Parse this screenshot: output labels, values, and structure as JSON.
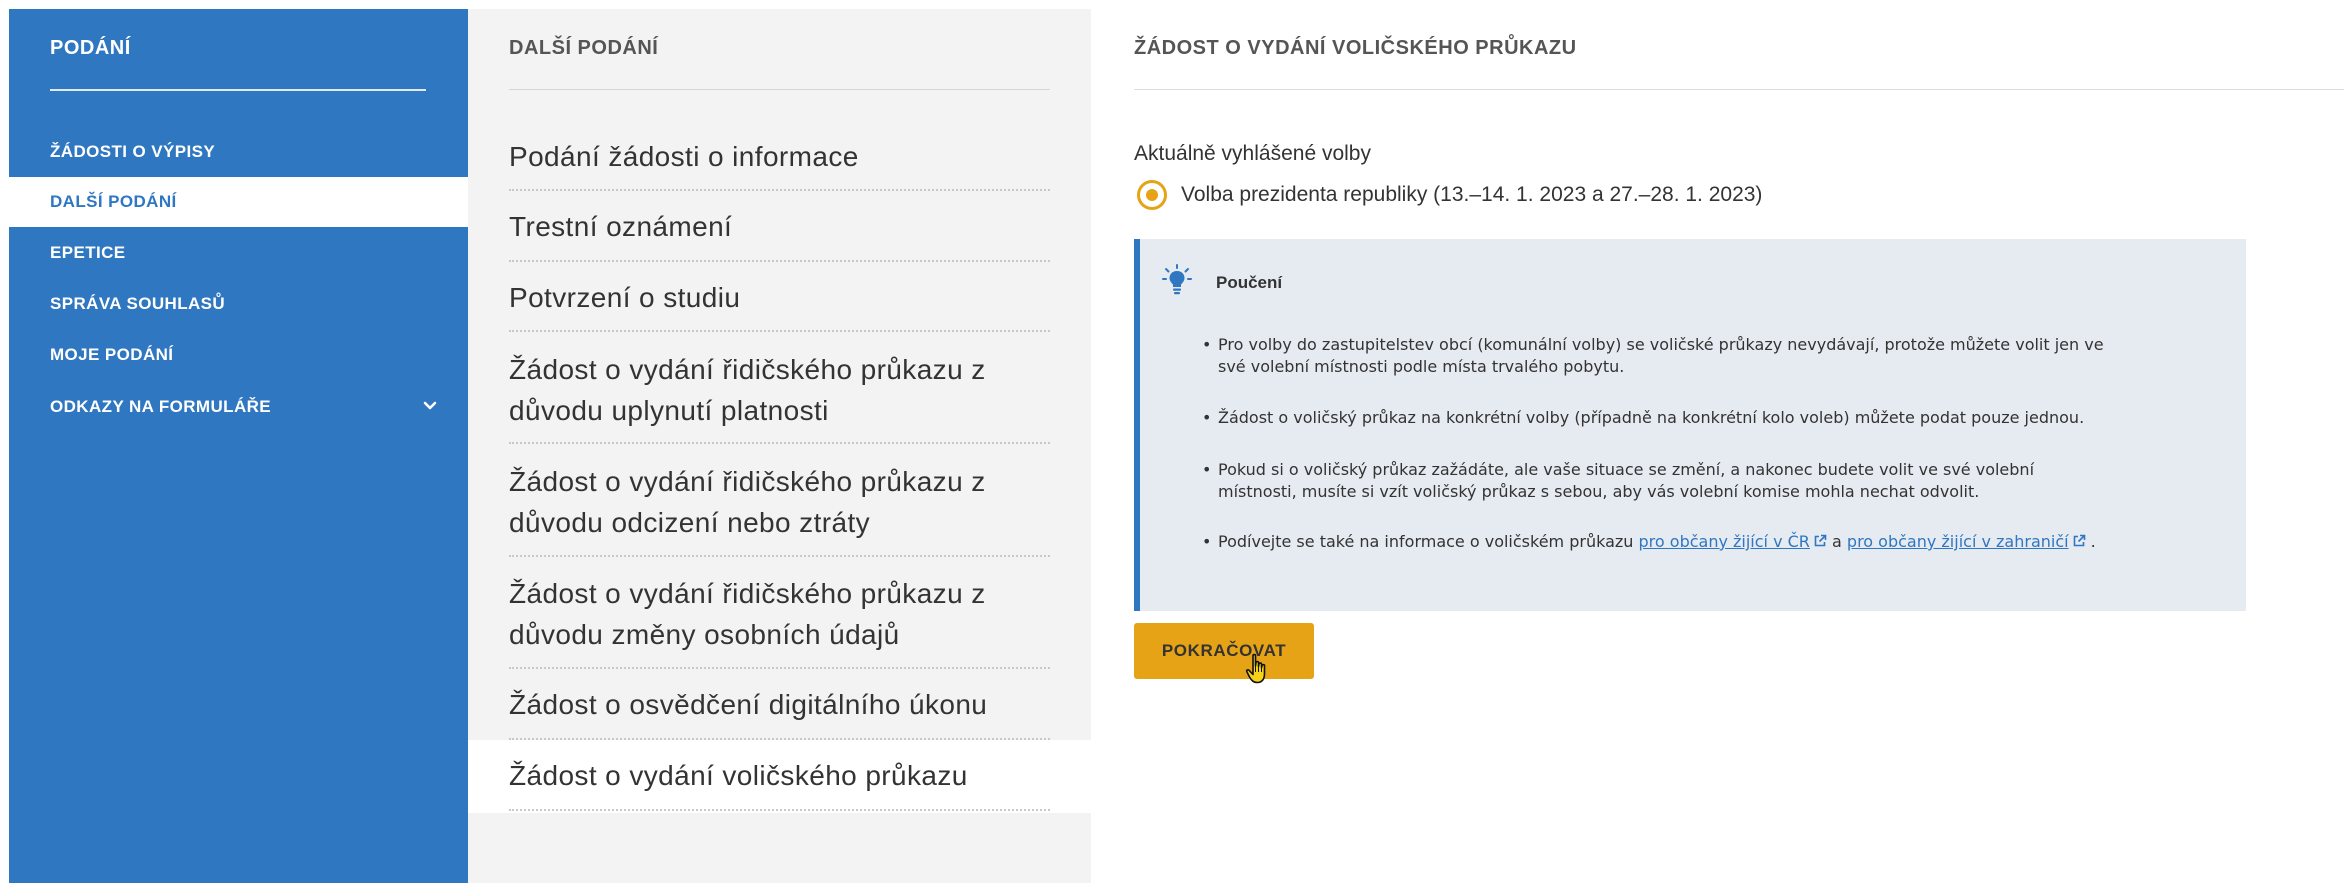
{
  "sidebar": {
    "title": "PODÁNÍ",
    "items": [
      {
        "label": "ŽÁDOSTI O VÝPISY"
      },
      {
        "label": "DALŠÍ PODÁNÍ"
      },
      {
        "label": "EPETICE"
      },
      {
        "label": "SPRÁVA SOUHLASŮ"
      },
      {
        "label": "MOJE PODÁNÍ"
      },
      {
        "label": "ODKAZY NA FORMULÁŘE"
      }
    ],
    "active_index": 1
  },
  "middle": {
    "title": "DALŠÍ PODÁNÍ",
    "items": [
      {
        "label": "Podání žádosti o informace"
      },
      {
        "label": "Trestní oznámení"
      },
      {
        "label": "Potvrzení o studiu"
      },
      {
        "line1": "Žádost o vydání řidičského průkazu z",
        "line2": "důvodu uplynutí platnosti"
      },
      {
        "line1": "Žádost o vydání řidičského průkazu z",
        "line2": "důvodu odcizení nebo ztráty"
      },
      {
        "line1": "Žádost o vydání řidičského průkazu z",
        "line2": "důvodu změny osobních údajů"
      },
      {
        "label": "Žádost o osvědčení digitálního úkonu"
      },
      {
        "label": "Žádost o vydání voličského průkazu"
      }
    ]
  },
  "content": {
    "title": "ŽÁDOST O VYDÁNÍ VOLIČSKÉHO PRŮKAZU",
    "elections_label": "Aktuálně vyhlášené volby",
    "election_option": "Volba prezidenta republiky (13.–14. 1. 2023 a 27.–28. 1. 2023)",
    "info": {
      "title": "Poučení",
      "bullets": [
        {
          "line1": "Pro volby do zastupitelstev obcí (komunální volby) se voličské průkazy nevydávají, protože můžete volit jen ve",
          "line2": "své volební místnosti podle místa trvalého pobytu."
        },
        {
          "line1": "Žádost o voličský průkaz na konkrétní volby (případně na konkrétní kolo voleb) můžete podat pouze jednou."
        },
        {
          "line1": "Pokud si o voličský průkaz zažádáte, ale vaše situace se změní, a nakonec budete volit ve své volební",
          "line2": "místnosti, musíte si vzít voličský průkaz s sebou, aby vás volební komise mohla nechat odvolit."
        },
        {
          "prefix": "Podívejte se také na informace o voličském průkazu ",
          "link1": "pro občany žijící v ČR",
          "middle": " a ",
          "link2": "pro občany žijící v zahraničí",
          "suffix": " ."
        }
      ]
    },
    "continue_button": "POKRAČOVAT"
  },
  "colors": {
    "primary_blue": "#2f77c0",
    "accent_yellow": "#e7a316",
    "info_bg": "#e6eaf1",
    "middle_bg": "#f3f3f3"
  },
  "icons": {
    "info": "lightbulb-icon",
    "expand": "chevron-down-icon",
    "external": "external-link-icon",
    "pointer": "hand-cursor-icon"
  }
}
